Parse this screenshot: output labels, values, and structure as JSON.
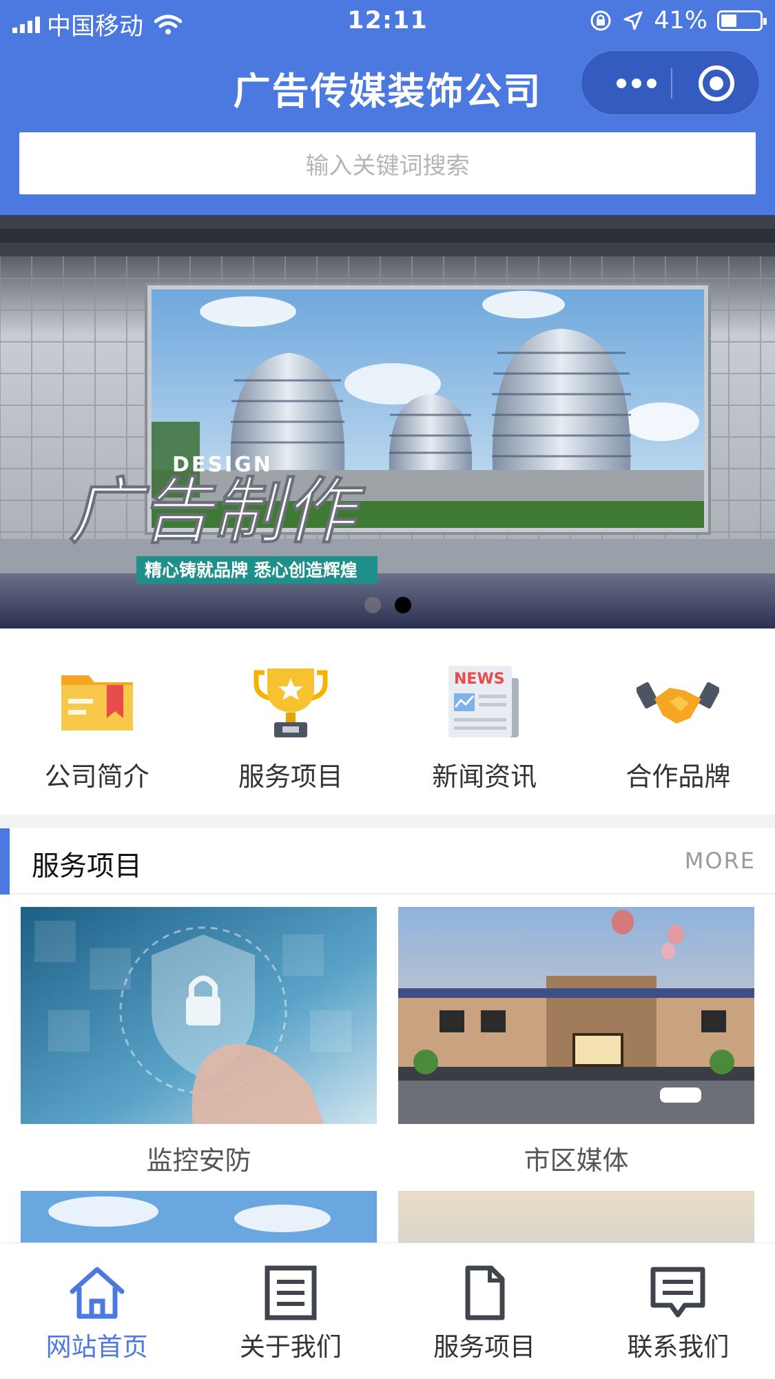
{
  "status_bar": {
    "carrier": "中国移动",
    "time": "12:11",
    "battery": "41%",
    "battery_level": 0.41
  },
  "nav": {
    "title": "广告传媒装饰公司"
  },
  "search": {
    "placeholder": "输入关键词搜索"
  },
  "banner": {
    "design_text": "DESIGN",
    "headline": "广告制作",
    "slogan": "精心铸就品牌 悉心创造辉煌",
    "slide_count": 2,
    "active_slide": 2
  },
  "quick_nav": [
    {
      "label": "公司简介",
      "icon": "folder-icon"
    },
    {
      "label": "服务项目",
      "icon": "trophy-icon"
    },
    {
      "label": "新闻资讯",
      "icon": "newspaper-icon"
    },
    {
      "label": "合作品牌",
      "icon": "handshake-icon"
    }
  ],
  "news_icon_text": "NEWS",
  "section": {
    "title": "服务项目",
    "more": "MORE"
  },
  "services": [
    {
      "label": "监控安防"
    },
    {
      "label": "市区媒体"
    }
  ],
  "tabbar": [
    {
      "label": "网站首页",
      "icon": "home-icon",
      "active": true
    },
    {
      "label": "关于我们",
      "icon": "document-list-icon",
      "active": false
    },
    {
      "label": "服务项目",
      "icon": "file-icon",
      "active": false
    },
    {
      "label": "联系我们",
      "icon": "message-icon",
      "active": false
    }
  ],
  "colors": {
    "brand": "#4c79e0",
    "tab_active": "#4c79e0"
  }
}
